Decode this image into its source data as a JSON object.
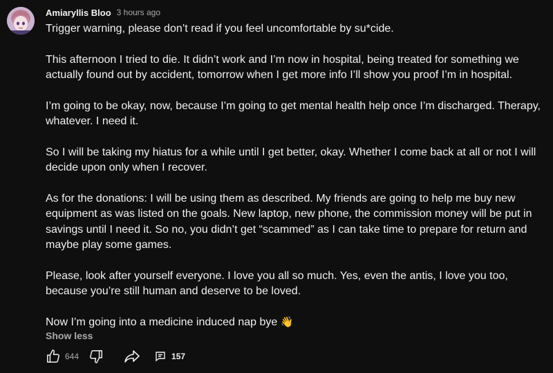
{
  "comment": {
    "author": "Amiaryllis Bloo",
    "timestamp": "3 hours ago",
    "paragraphs": [
      "Trigger warning, please don’t read if you feel uncomfortable by su*cide.",
      "This afternoon I tried to die. It didn’t work and I’m now in hospital, being treated for something we actually found out by accident, tomorrow when I get more info I’ll show you proof I’m in hospital.",
      "I’m going to be okay, now, because I’m going to get mental health help once I’m discharged. Therapy, whatever. I need it.",
      "So I will be taking my hiatus for a while until I get better, okay. Whether I come back at all or not I will decide upon only when I recover.",
      "As for the donations: I will be using them as described. My friends are going to help me buy new equipment as was listed on the goals. New laptop, new phone, the commission money will be put in savings until I need it. So no, you didn’t get “scammed” as I can take time to prepare for return and maybe play some games.",
      "Please, look after yourself everyone. I love you all so much. Yes, even the antis, I love you too, because you’re still human and deserve to be loved."
    ],
    "last_line": "Now I’m going into a medicine induced nap bye",
    "emoji": "👋",
    "show_less_label": "Show less",
    "like_count": "644",
    "reply_count": "157"
  },
  "icons": {
    "avatar": "avatar",
    "like": "thumbs-up-icon",
    "dislike": "thumbs-down-icon",
    "share": "share-arrow-icon",
    "replies": "comment-icon"
  },
  "colors": {
    "background": "#0f0f0f",
    "text": "#f1f1f1",
    "secondary_text": "#aaaaaa",
    "emoji": "#f5c542"
  }
}
